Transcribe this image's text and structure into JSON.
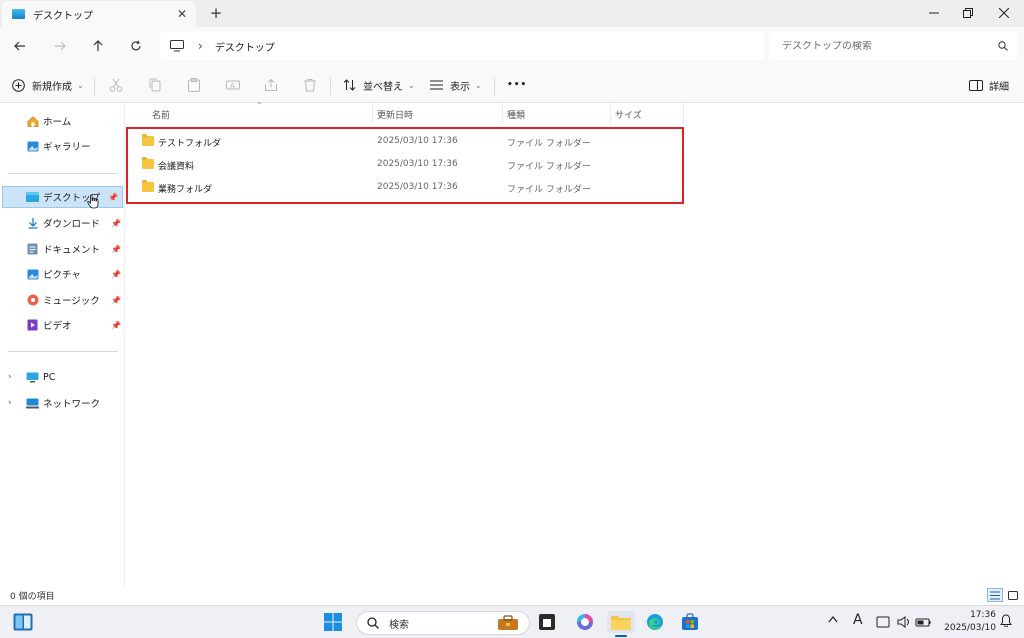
{
  "window": {
    "tab_label": "デスクトップ",
    "tab_close": "✕",
    "new_tab": "+"
  },
  "address": {
    "separator": "›",
    "crumb": "デスクトップ",
    "search_placeholder": "デスクトップの検索"
  },
  "commands": {
    "new_label": "新規作成",
    "sort_label": "並べ替え",
    "view_label": "表示",
    "more": "•••",
    "details_label": "詳細"
  },
  "sidebar": {
    "quick": [
      {
        "label": "ホーム",
        "icon": "home-icon"
      },
      {
        "label": "ギャラリー",
        "icon": "gallery-icon"
      }
    ],
    "pinned": [
      {
        "label": "デスクトップ",
        "icon": "desktop-folder-icon",
        "selected": true
      },
      {
        "label": "ダウンロード",
        "icon": "download-icon"
      },
      {
        "label": "ドキュメント",
        "icon": "documents-icon"
      },
      {
        "label": "ピクチャ",
        "icon": "pictures-icon"
      },
      {
        "label": "ミュージック",
        "icon": "music-icon"
      },
      {
        "label": "ビデオ",
        "icon": "videos-icon"
      }
    ],
    "locations": [
      {
        "label": "PC",
        "icon": "pc-icon"
      },
      {
        "label": "ネットワーク",
        "icon": "network-icon"
      }
    ]
  },
  "columns": {
    "name": "名前",
    "modified": "更新日時",
    "type": "種類",
    "size": "サイズ"
  },
  "files": [
    {
      "name": "テストフォルダ",
      "modified": "2025/03/10 17:36",
      "type": "ファイル フォルダー"
    },
    {
      "name": "会議資料",
      "modified": "2025/03/10 17:36",
      "type": "ファイル フォルダー"
    },
    {
      "name": "業務フォルダ",
      "modified": "2025/03/10 17:36",
      "type": "ファイル フォルダー"
    }
  ],
  "status": {
    "item_count": "0 個の項目"
  },
  "taskbar": {
    "search_label": "検索",
    "ime": "A",
    "time": "17:36",
    "date": "2025/03/10"
  },
  "colors": {
    "highlight": "#d8232a",
    "selection": "#cce4f7",
    "accent": "#0067c0"
  }
}
